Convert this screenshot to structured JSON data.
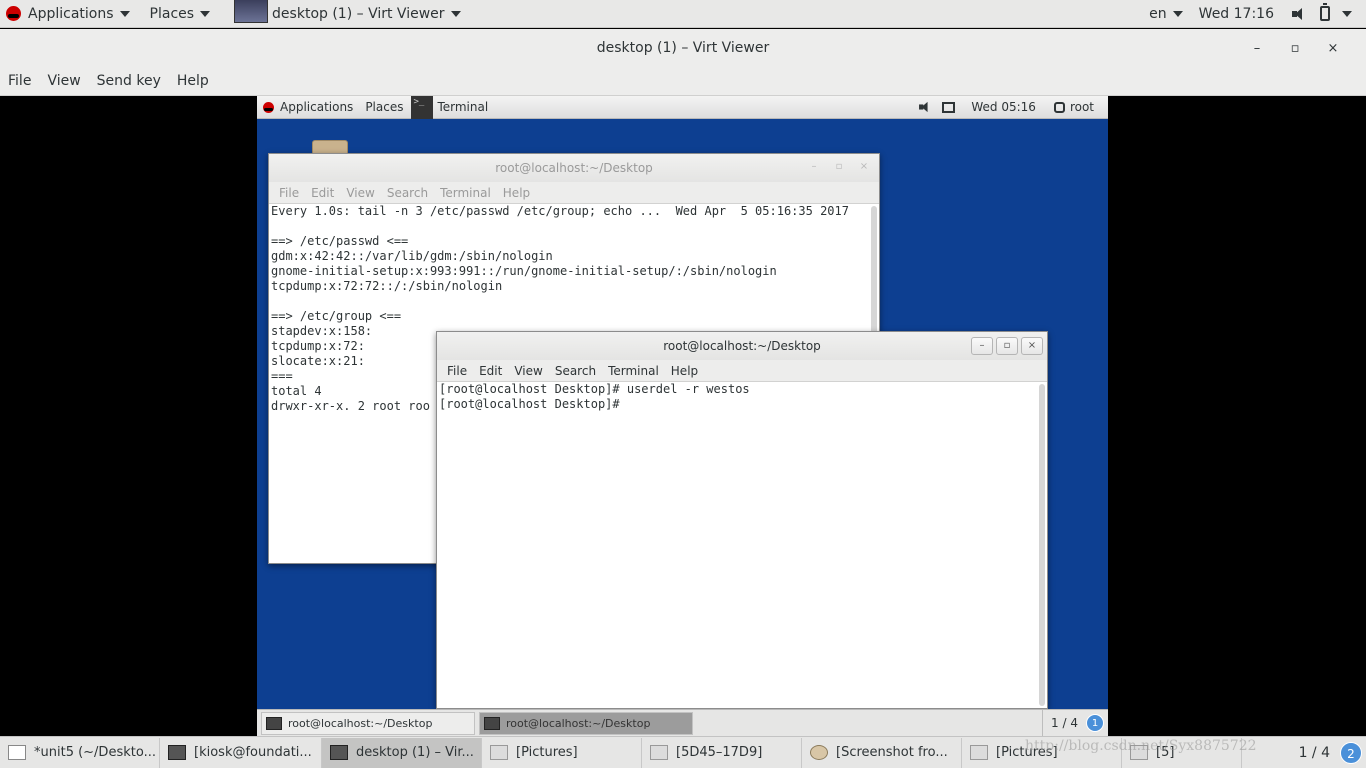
{
  "host_topbar": {
    "applications": "Applications",
    "places": "Places",
    "active_window": "desktop (1) – Virt Viewer",
    "language": "en",
    "clock": "Wed 17:16"
  },
  "viewer": {
    "title": "desktop (1) – Virt Viewer",
    "minimize": "–",
    "maximize": "▫",
    "close": "×",
    "menu": [
      "File",
      "View",
      "Send key",
      "Help"
    ]
  },
  "guest_topbar": {
    "applications": "Applications",
    "places": "Places",
    "terminal": "Terminal",
    "clock": "Wed 05:16",
    "user": "root"
  },
  "terminal_back": {
    "title": "root@localhost:~/Desktop",
    "menu": [
      "File",
      "Edit",
      "View",
      "Search",
      "Terminal",
      "Help"
    ],
    "content": "Every 1.0s: tail -n 3 /etc/passwd /etc/group; echo ...  Wed Apr  5 05:16:35 2017\n\n==> /etc/passwd <==\ngdm:x:42:42::/var/lib/gdm:/sbin/nologin\ngnome-initial-setup:x:993:991::/run/gnome-initial-setup/:/sbin/nologin\ntcpdump:x:72:72::/:/sbin/nologin\n\n==> /etc/group <==\nstapdev:x:158:\ntcpdump:x:72:\nslocate:x:21:\n===\ntotal 4\ndrwxr-xr-x. 2 root roo"
  },
  "terminal_front": {
    "title": "root@localhost:~/Desktop",
    "menu": [
      "File",
      "Edit",
      "View",
      "Search",
      "Terminal",
      "Help"
    ],
    "content": "[root@localhost Desktop]# userdel -r westos\n[root@localhost Desktop]#"
  },
  "guest_taskbar": {
    "tasks": [
      "root@localhost:~/Desktop",
      "root@localhost:~/Desktop"
    ],
    "pager": "1 / 4",
    "notifications": "1"
  },
  "host_taskbar": {
    "tasks": [
      "*unit5 (~/Deskto...",
      "[kiosk@foundati...",
      "desktop (1) – Vir...",
      "[Pictures]",
      "[5D45–17D9]",
      "[Screenshot fro...",
      "[Pictures]",
      "[5]"
    ],
    "pager": "1 / 4",
    "notifications": "2"
  },
  "watermark": "http://blog.csdn.net/Syx8875722"
}
